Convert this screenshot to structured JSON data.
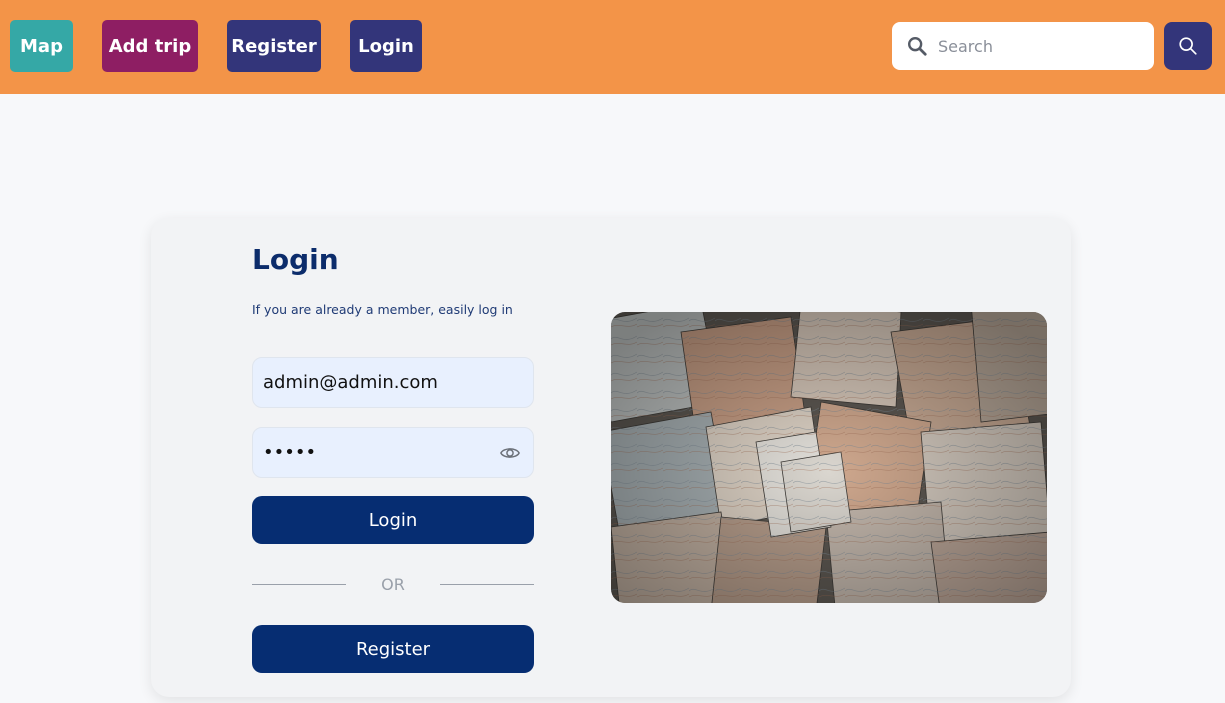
{
  "nav": {
    "map": "Map",
    "add_trip": "Add trip",
    "register": "Register",
    "login": "Login"
  },
  "search": {
    "placeholder": "Search"
  },
  "login_form": {
    "title": "Login",
    "subtitle": "If you are already a member, easily log in",
    "email_value": "admin@admin.com",
    "password_value": "admin",
    "login_button": "Login",
    "divider_text": "OR",
    "register_button": "Register"
  },
  "colors": {
    "topbar": "#f39448",
    "map_button": "#35a8a6",
    "add_trip_button": "#8e1e63",
    "nav_dark_button": "#33357a",
    "primary_button": "#062d72",
    "input_background": "#e8f0fe"
  },
  "icons": {
    "search": "search-icon",
    "search_button": "search-icon",
    "password_toggle": "eye-icon"
  }
}
